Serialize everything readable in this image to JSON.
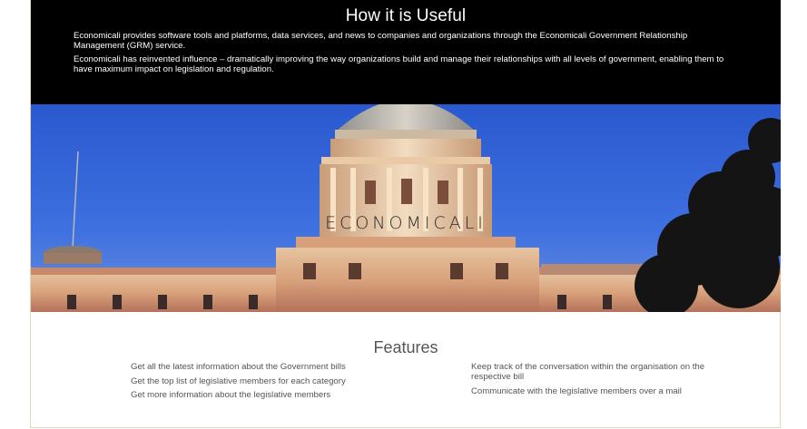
{
  "useful_section": {
    "title": "How it is Useful",
    "paragraph1": "Economicali provides software tools and platforms, data services, and news to companies and organizations through the Economicali Government Relationship Management (GRM) service.",
    "paragraph2": "Economicali has reinvented influence – dramatically improving the way organizations build and manage their relationships with all levels of government, enabling them to have maximum impact on legislation and regulation."
  },
  "hero": {
    "title": "ECONOMICALI"
  },
  "features": {
    "title": "Features",
    "left_items": [
      "Get all the latest information about the Government bills",
      "Get the top list of legislative members for each category",
      "Get more information about the legislative members"
    ],
    "right_items": [
      "Keep track of the conversation within the organisation on the respective bill",
      "Communicate with the legislative members over a mail"
    ]
  },
  "colors": {
    "band_background": "#000000",
    "sky": "#3c6ee0",
    "text_gray": "#555555",
    "border": "#e8d2b8"
  }
}
